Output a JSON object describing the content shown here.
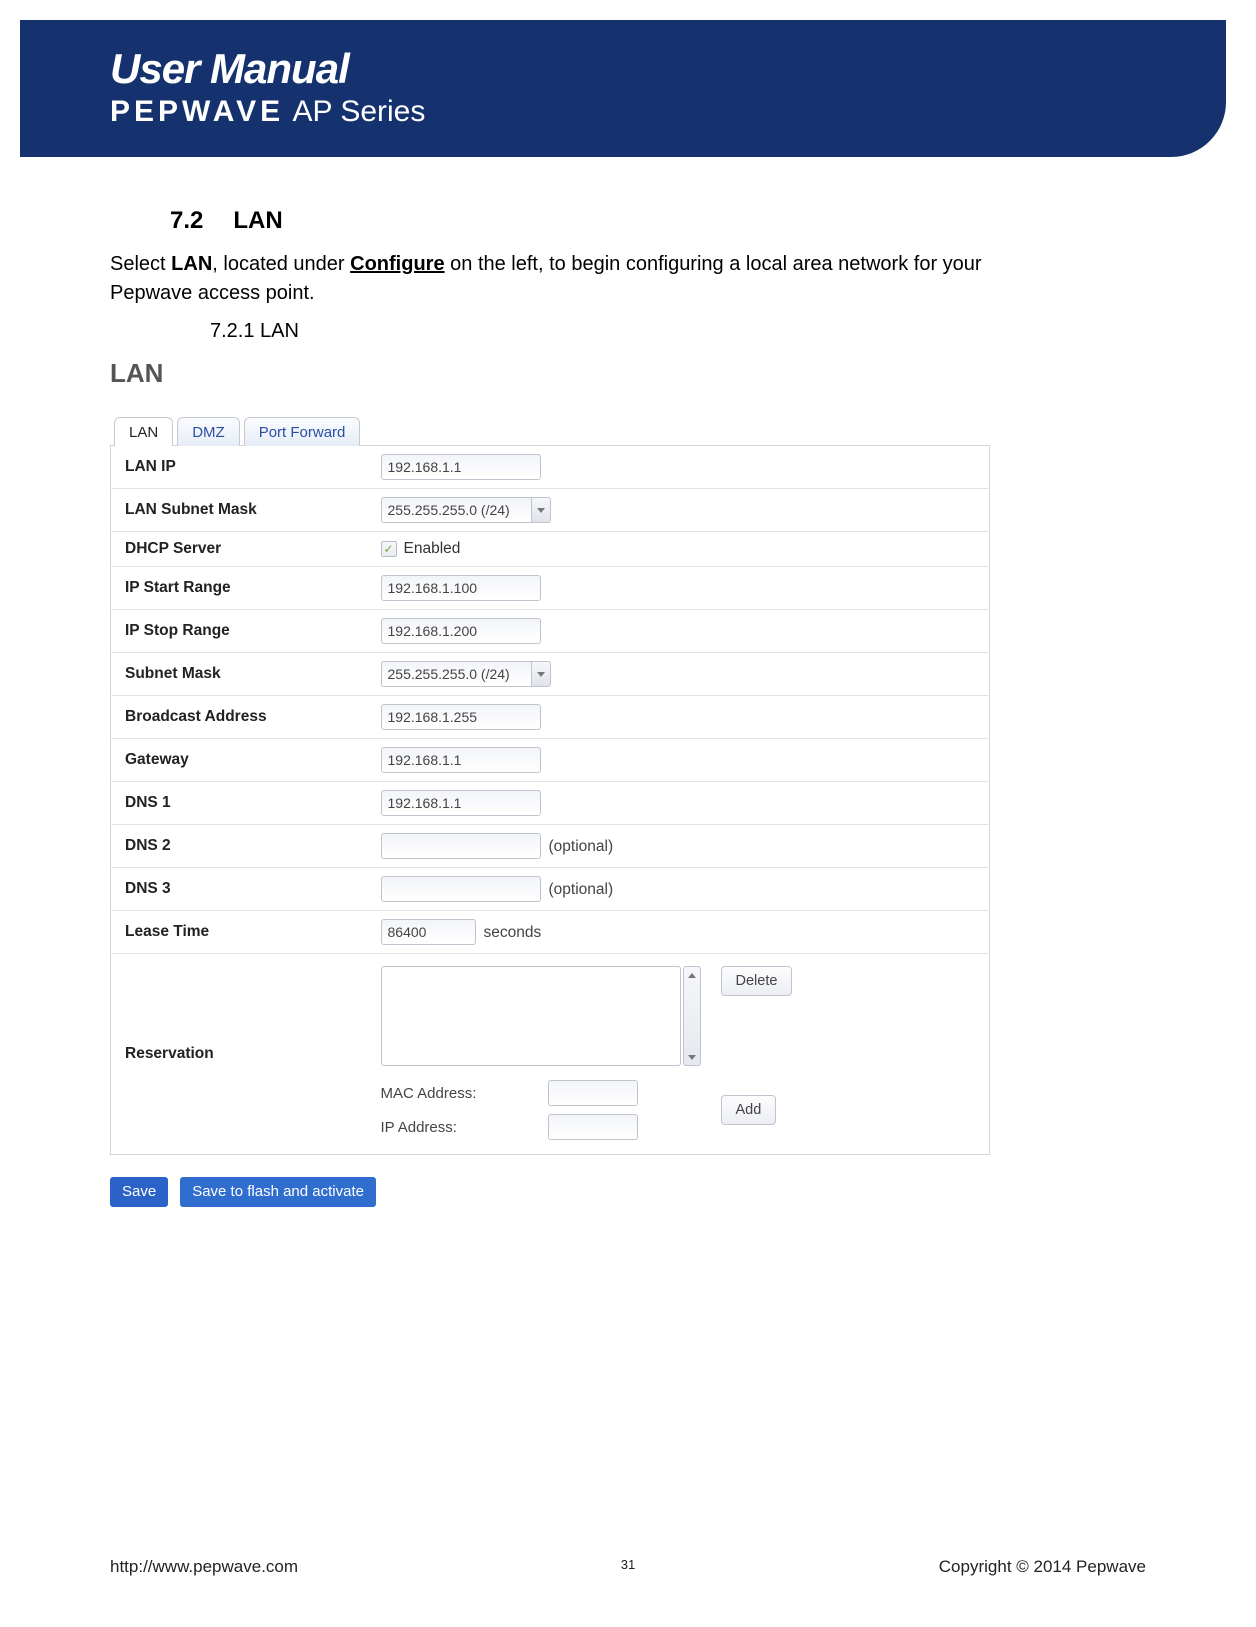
{
  "header": {
    "title": "User Manual",
    "brand": "PEPWAVE",
    "series": "AP Series"
  },
  "section": {
    "number": "7.2",
    "title": "LAN",
    "intro_pre": "Select ",
    "intro_b1": "LAN",
    "intro_mid": ", located under ",
    "intro_b2": "Configure",
    "intro_post": " on the left, to begin configuring a local area network for your Pepwave access point.",
    "subsection": "7.2.1 LAN",
    "panel_title": "LAN"
  },
  "tabs": {
    "active": "LAN",
    "dmz": "DMZ",
    "pf": "Port Forward"
  },
  "form": {
    "lan_ip": {
      "label": "LAN IP",
      "value": "192.168.1.1"
    },
    "subnet_mask_top": {
      "label": "LAN Subnet Mask",
      "value": "255.255.255.0 (/24)"
    },
    "dhcp": {
      "label": "DHCP Server",
      "text": "Enabled",
      "checked": true
    },
    "ip_start": {
      "label": "IP Start Range",
      "value": "192.168.1.100"
    },
    "ip_stop": {
      "label": "IP Stop Range",
      "value": "192.168.1.200"
    },
    "subnet_mask": {
      "label": "Subnet Mask",
      "value": "255.255.255.0 (/24)"
    },
    "broadcast": {
      "label": "Broadcast Address",
      "value": "192.168.1.255"
    },
    "gateway": {
      "label": "Gateway",
      "value": "192.168.1.1"
    },
    "dns1": {
      "label": "DNS 1",
      "value": "192.168.1.1"
    },
    "dns2": {
      "label": "DNS 2",
      "value": "",
      "suffix": "(optional)"
    },
    "dns3": {
      "label": "DNS 3",
      "value": "",
      "suffix": "(optional)"
    },
    "lease": {
      "label": "Lease Time",
      "value": "86400",
      "suffix": "seconds"
    },
    "reservation": {
      "label": "Reservation",
      "mac_label": "MAC Address:",
      "ip_label": "IP Address:",
      "delete": "Delete",
      "add": "Add"
    }
  },
  "buttons": {
    "save": "Save",
    "save_activate": "Save to flash and activate"
  },
  "footer": {
    "url": "http://www.pepwave.com",
    "page": "31",
    "copyright": "Copyright © 2014 Pepwave"
  }
}
